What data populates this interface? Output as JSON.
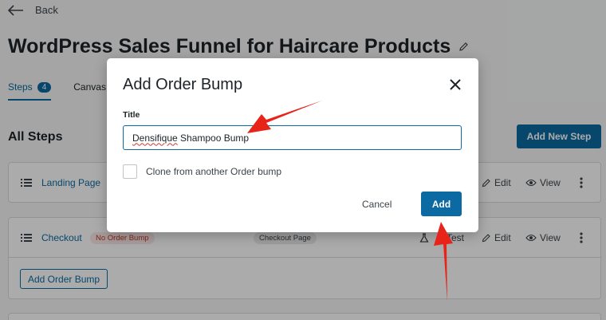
{
  "header": {
    "back_label": "Back",
    "page_title": "WordPress Sales Funnel for Haircare Products"
  },
  "tabs": [
    {
      "label": "Steps",
      "badge": "4",
      "active": true
    },
    {
      "label": "Canvas",
      "active": false
    }
  ],
  "steps_section": {
    "title": "All Steps",
    "add_new_step_label": "Add New Step"
  },
  "steps": [
    {
      "name": "Landing Page",
      "actions": [
        "Edit",
        "View"
      ]
    },
    {
      "name": "Checkout",
      "status_badge": "No Order Bump",
      "type_badge": "Checkout Page",
      "actions": [
        "Test",
        "Edit",
        "View"
      ],
      "add_bump_label": "Add Order Bump"
    }
  ],
  "modal": {
    "title": "Add Order Bump",
    "field_label": "Title",
    "input_value_word1": "Densifique",
    "input_value_rest": " Shampoo Bump",
    "checkbox_label": "Clone from another Order bump",
    "checkbox_checked": false,
    "cancel_label": "Cancel",
    "add_label": "Add"
  },
  "colors": {
    "accent": "#0b6aa2",
    "annotation_arrow": "#e8231a",
    "overlay": "rgba(0,0,0,0.33)"
  }
}
